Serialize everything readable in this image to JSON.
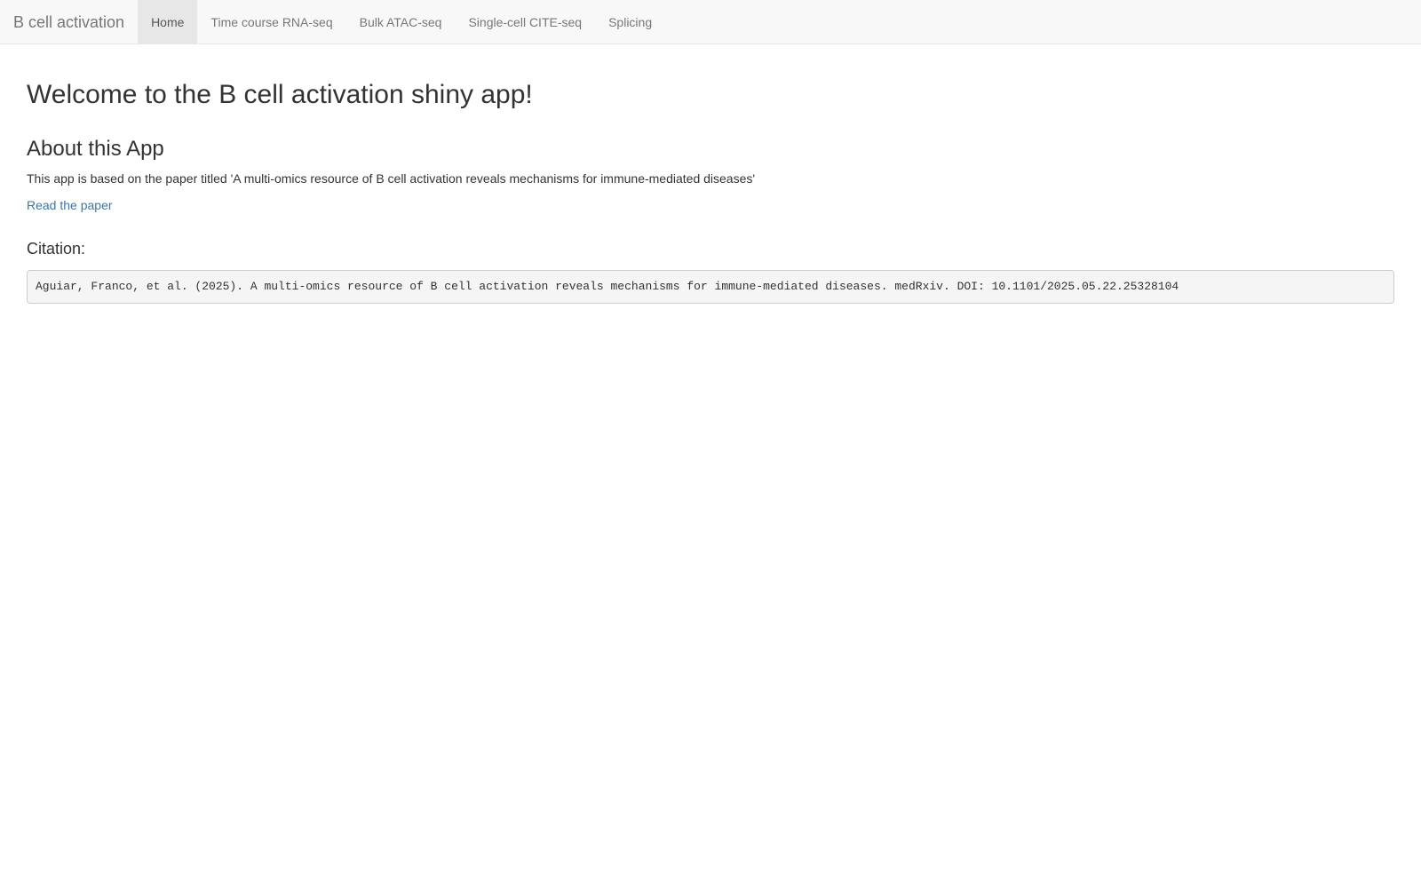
{
  "navbar": {
    "brand": "B cell activation",
    "tabs": [
      {
        "label": "Home",
        "active": true
      },
      {
        "label": "Time course RNA-seq",
        "active": false
      },
      {
        "label": "Bulk ATAC-seq",
        "active": false
      },
      {
        "label": "Single-cell CITE-seq",
        "active": false
      },
      {
        "label": "Splicing",
        "active": false
      }
    ]
  },
  "main": {
    "title": "Welcome to the B cell activation shiny app!",
    "about_heading": "About this App",
    "about_text": "This app is based on the paper titled 'A multi-omics resource of B cell activation reveals mechanisms for immune-mediated diseases'",
    "paper_link": "Read the paper",
    "citation_heading": "Citation:",
    "citation_text": "Aguiar, Franco, et al. (2025). A multi-omics resource of B cell activation reveals mechanisms for immune-mediated diseases. medRxiv. DOI: 10.1101/2025.05.22.25328104"
  },
  "colors": {
    "link": "#337ab7",
    "navbar_bg": "#f8f8f8",
    "active_tab_bg": "#e7e7e7"
  }
}
